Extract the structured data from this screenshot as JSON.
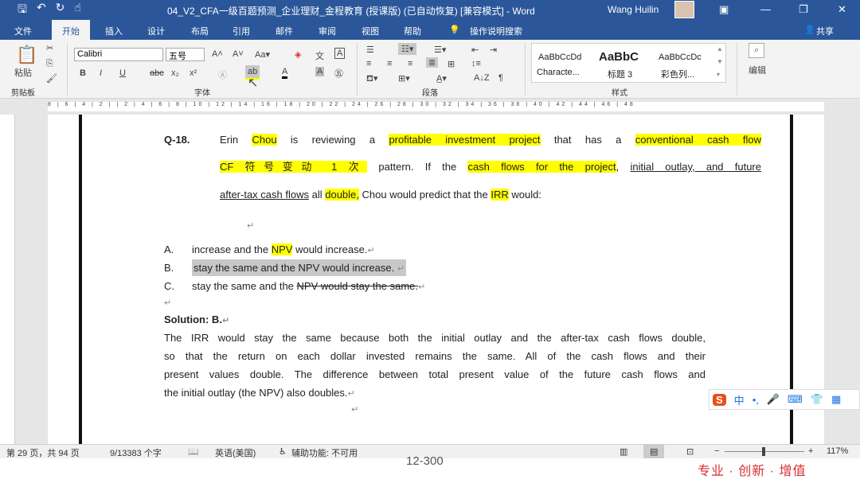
{
  "titlebar": {
    "document_title": "04_V2_CFA一级百题预测_企业理财_金程教育 (授课版) (已自动恢复) [兼容模式] - Word",
    "user": "Wang Huilin",
    "save_icon": "save-icon",
    "undo_icon": "undo-icon",
    "redo_icon": "redo-icon",
    "touch_icon": "touch-mode-icon"
  },
  "tabs": [
    "文件",
    "开始",
    "插入",
    "设计",
    "布局",
    "引用",
    "邮件",
    "审阅",
    "视图",
    "帮助"
  ],
  "tell_me": "操作说明搜索",
  "share": "共享",
  "ribbon": {
    "paste": "粘贴",
    "clipboard": "剪贴板",
    "font_name": "Calibri",
    "font_size": "五号",
    "font_group": "字体",
    "paragraph_group": "段落",
    "styles_group": "样式",
    "edit": "编辑",
    "styles": [
      {
        "preview": "AaBbCcDd",
        "name": "Characte..."
      },
      {
        "preview": "AaBbC",
        "name": "标题 3"
      },
      {
        "preview": "AaBbCcDc",
        "name": "彩色列..."
      }
    ]
  },
  "ruler_marks": "8 | 6 | 4 | 2 | | 2 | 4 | 6 | 8 | 10 | 12 | 14 | 16 | 18 | 20 | 22 | 24 | 26 | 28 | 30 | 32 | 34 | 36 | 38 | 40 | 42 | 44 | 46 | 48",
  "document": {
    "q_label": "Q-18.",
    "q1": [
      "Erin ",
      "Chou",
      " is reviewing a ",
      "profitable investment project",
      " that has a ",
      "conventional cash flow"
    ],
    "q2": [
      "CF 符号变动 1 次",
      " pattern. If the ",
      "cash flows for the project",
      ", ",
      "initial outlay, and future"
    ],
    "q3": [
      "after-tax cash flows",
      " all ",
      "double,",
      " Chou would predict that the ",
      "IRR",
      " would:"
    ],
    "options": [
      {
        "label": "A.",
        "text_a": "increase and the ",
        "hl": "NPV",
        "text_b": " would increase."
      },
      {
        "label": "B.",
        "text": "stay the same and the NPV would increase."
      },
      {
        "label": "C.",
        "text_a": "stay the same and the ",
        "strike": "NPV would stay the same."
      }
    ],
    "solution_label": "Solution: B.",
    "solution": [
      "The IRR would stay the same because both the initial outlay and the after-tax cash flows double,",
      "so that the return on each dollar invested remains the same. All of the cash flows and their",
      "present values double. The difference between total present value of the future cash flows and",
      "the initial outlay (the NPV) also doubles."
    ],
    "para_mark": "↵"
  },
  "status": {
    "page": "第 29 页，共 94 页",
    "words": "9/13383 个字",
    "language": "英语(美国)",
    "accessibility": "辅助功能: 不可用",
    "zoom": "117%"
  },
  "ime": {
    "label": "中"
  },
  "footer": {
    "page_number": "12-300",
    "slogan": "专业 · 创新 · 增值"
  }
}
